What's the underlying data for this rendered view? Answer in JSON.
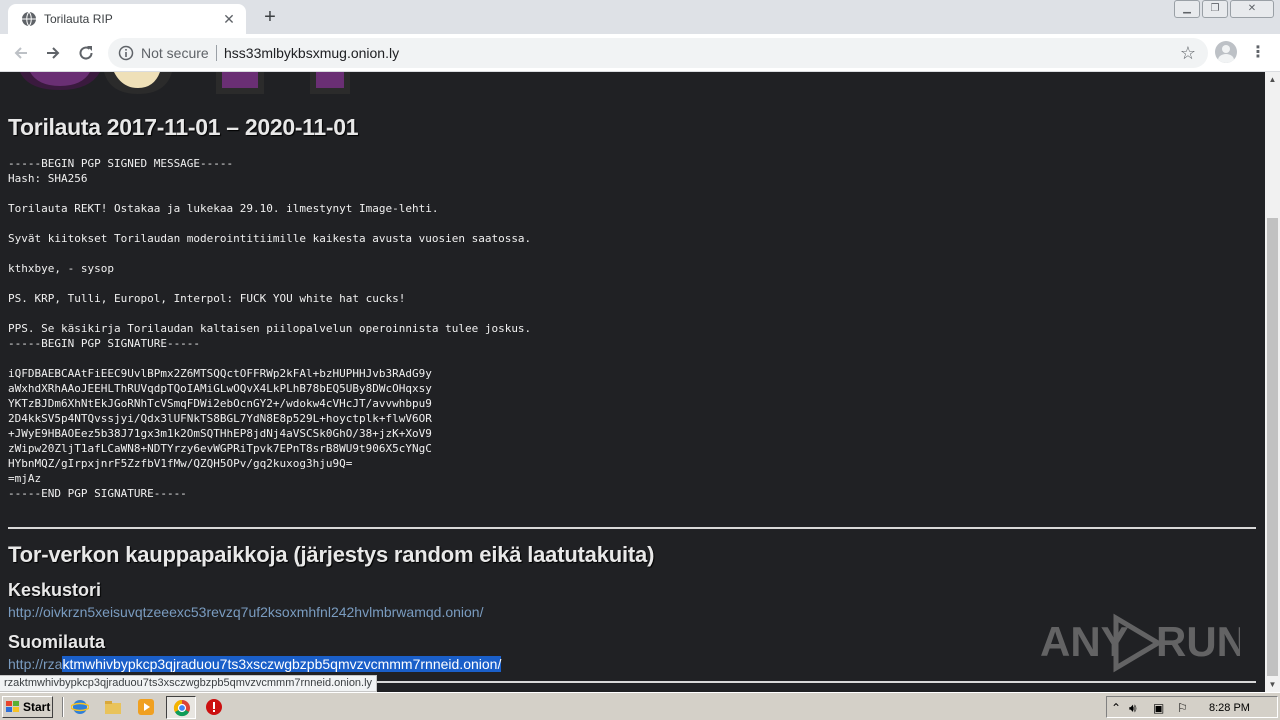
{
  "browser": {
    "tab_title": "Torilauta RIP",
    "security_label": "Not secure",
    "url": "hss33mlbykbsxmug.onion.ly",
    "status_url": "rzaktmwhivbypkcp3qjraduou7ts3xsczwgbzpb5qmvzvcmmm7rnneid.onion.ly"
  },
  "page": {
    "heading": "Torilauta 2017-11-01 – 2020-11-01",
    "pgp_lines": [
      "-----BEGIN PGP SIGNED MESSAGE-----",
      "Hash: SHA256",
      "",
      "Torilauta REKT! Ostakaa ja lukekaa 29.10. ilmestynyt Image-lehti.",
      "",
      "Syvät kiitokset Torilaudan moderointitiimille kaikesta avusta vuosien saatossa.",
      "",
      "kthxbye, - sysop",
      "",
      "PS. KRP, Tulli, Europol, Interpol: FUCK YOU white hat cucks!",
      "",
      "PPS. Se käsikirja Torilaudan kaltaisen piilopalvelun operoinnista tulee joskus.",
      "-----BEGIN PGP SIGNATURE-----",
      "",
      "iQFDBAEBCAAtFiEEC9UvlBPmx2Z6MTSQQctOFFRWp2kFAl+bzHUPHHJvb3RAdG9y",
      "aWxhdXRhAAoJEEHLThRUVqdpTQoIAMiGLwOQvX4LkPLhB78bEQ5UBy8DWcOHqxsy",
      "YKTzBJDm6XhNtEkJGoRNhTcVSmqFDWi2ebOcnGY2+/wdokw4cVHcJT/avvwhbpu9",
      "2D4kkSV5p4NTQvssjyi/Qdx3lUFNkTS8BGL7YdN8E8p529L+hoyctplk+flwV6OR",
      "+JWyE9HBAOEez5b38J71gx3m1k2OmSQTHhEP8jdNj4aVSCSk0GhO/38+jzK+XoV9",
      "zWipw20ZljT1afLCaWN8+NDTYrzy6evWGPRiTpvk7EPnT8srB8WU9t906X5cYNgC",
      "HYbnMQZ/gIrpxjnrF5ZzfbV1fMw/QZQH5OPv/gq2kuxog3hju9Q=",
      "=mjAz",
      "-----END PGP SIGNATURE-----"
    ],
    "markets_heading": "Tor-verkon kauppapaikkoja (järjestys random eikä laatutakuita)",
    "markets": [
      {
        "name": "Keskustori",
        "link_plain": "http://oivkrzn5xeisuvqtzeeexc53revzq7uf2ksoxmhfnl242hvlmbrwamqd.onion/",
        "link_selected": ""
      },
      {
        "name": "Suomilauta",
        "link_plain": "http://rza",
        "link_selected": "ktmwhivbypkcp3qjraduou7ts3xsczwgbzpb5qmvzvcmmm7rnneid.onion/"
      }
    ]
  },
  "watermark": {
    "text": "ANY RUN"
  },
  "taskbar": {
    "start_label": "Start",
    "clock": "8:28 PM"
  },
  "colors": {
    "page_bg": "#202124",
    "link": "#7a9cc0",
    "selection": "#1a5fc9"
  }
}
